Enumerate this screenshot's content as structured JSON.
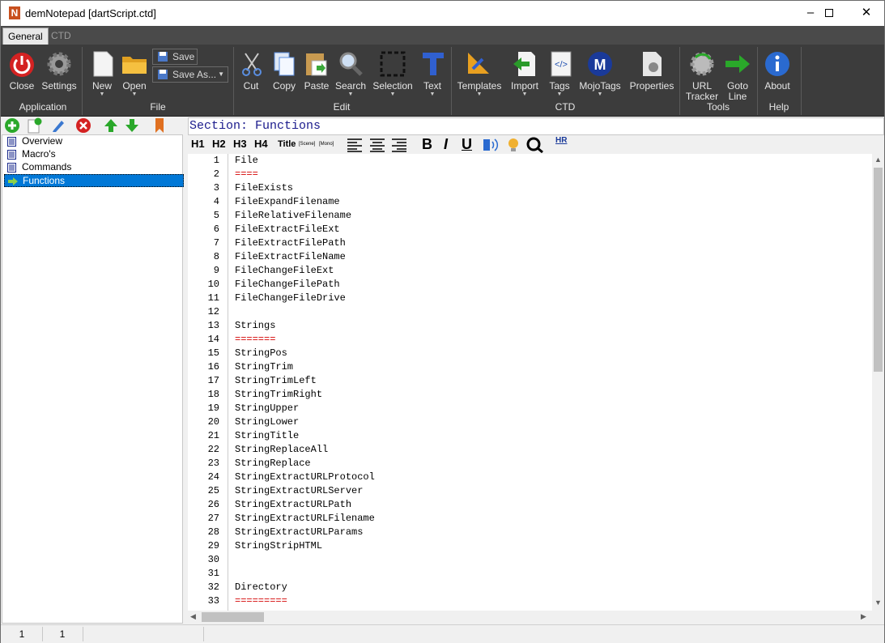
{
  "window": {
    "title": "demNotepad [dartScript.ctd]"
  },
  "tabs": [
    {
      "label": "General"
    },
    {
      "label": "CTD"
    }
  ],
  "ribbon": {
    "application": {
      "group": "Application",
      "close": "Close",
      "settings": "Settings"
    },
    "file": {
      "group": "File",
      "new": "New",
      "open": "Open",
      "save": "Save",
      "save_as": "Save As..."
    },
    "edit": {
      "group": "Edit",
      "cut": "Cut",
      "copy": "Copy",
      "paste": "Paste",
      "search": "Search",
      "selection": "Selection",
      "text": "Text"
    },
    "ctd": {
      "group": "CTD",
      "templates": "Templates",
      "import": "Import",
      "tags": "Tags",
      "mojotags": "MojoTags",
      "properties": "Properties"
    },
    "tools": {
      "group": "Tools",
      "url_tracker_1": "URL",
      "url_tracker_2": "Tracker",
      "goto_line_1": "Goto",
      "goto_line_2": "Line"
    },
    "help": {
      "group": "Help",
      "about": "About"
    }
  },
  "tree": {
    "items": [
      {
        "label": "Overview"
      },
      {
        "label": "Macro's"
      },
      {
        "label": "Commands"
      },
      {
        "label": "Functions"
      }
    ]
  },
  "section_label": "Section: Functions",
  "format_bar": {
    "h1": "H1",
    "h2": "H2",
    "h3": "H3",
    "h4": "H4",
    "title": "Title",
    "scene": "[Scene]",
    "mono": "[Mono]",
    "bold": "B",
    "italic": "I",
    "underline": "U",
    "hr": "HR"
  },
  "editor": {
    "lines": [
      {
        "n": "1",
        "t": "File"
      },
      {
        "n": "2",
        "t": "===="
      },
      {
        "n": "3",
        "t": "FileExists"
      },
      {
        "n": "4",
        "t": "FileExpandFilename"
      },
      {
        "n": "5",
        "t": "FileRelativeFilename"
      },
      {
        "n": "6",
        "t": "FileExtractFileExt"
      },
      {
        "n": "7",
        "t": "FileExtractFilePath"
      },
      {
        "n": "8",
        "t": "FileExtractFileName"
      },
      {
        "n": "9",
        "t": "FileChangeFileExt"
      },
      {
        "n": "10",
        "t": "FileChangeFilePath"
      },
      {
        "n": "11",
        "t": "FileChangeFileDrive"
      },
      {
        "n": "12",
        "t": ""
      },
      {
        "n": "13",
        "t": "Strings"
      },
      {
        "n": "14",
        "t": "======="
      },
      {
        "n": "15",
        "t": "StringPos"
      },
      {
        "n": "16",
        "t": "StringTrim"
      },
      {
        "n": "17",
        "t": "StringTrimLeft"
      },
      {
        "n": "18",
        "t": "StringTrimRight"
      },
      {
        "n": "19",
        "t": "StringUpper"
      },
      {
        "n": "20",
        "t": "StringLower"
      },
      {
        "n": "21",
        "t": "StringTitle"
      },
      {
        "n": "22",
        "t": "StringReplaceAll"
      },
      {
        "n": "23",
        "t": "StringReplace"
      },
      {
        "n": "24",
        "t": "StringExtractURLProtocol"
      },
      {
        "n": "25",
        "t": "StringExtractURLServer"
      },
      {
        "n": "26",
        "t": "StringExtractURLPath"
      },
      {
        "n": "27",
        "t": "StringExtractURLFilename"
      },
      {
        "n": "28",
        "t": "StringExtractURLParams"
      },
      {
        "n": "29",
        "t": "StringStripHTML"
      },
      {
        "n": "30",
        "t": ""
      },
      {
        "n": "31",
        "t": ""
      },
      {
        "n": "32",
        "t": "Directory"
      },
      {
        "n": "33",
        "t": "========="
      }
    ]
  },
  "statusbar": {
    "line": "1",
    "col": "1"
  },
  "colors": {
    "ribbon_bg": "#3c3c3c",
    "tab_bar_bg": "#4a4a4a",
    "selection": "#0078d7",
    "underline_red": "#d40000",
    "section_blue": "#1a1a8c"
  }
}
